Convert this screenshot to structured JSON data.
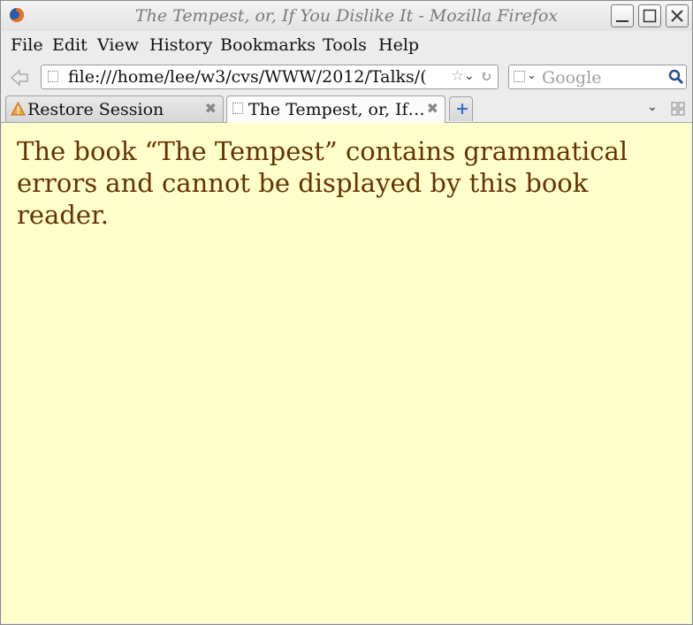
{
  "window": {
    "title": "The Tempest, or, If You Dislike It - Mozilla Firefox",
    "icon": "firefox-logo-icon",
    "controls": [
      "minimize-icon",
      "maximize-icon",
      "close-icon"
    ]
  },
  "menu": {
    "file": "File",
    "edit": "Edit",
    "view": "View",
    "history": "History",
    "bookmarks": "Bookmarks",
    "tools": "Tools",
    "help": "Help"
  },
  "navbar": {
    "url": "file:///home/lee/w3/cvs/WWW/2012/Talks/(",
    "search_placeholder": "Google"
  },
  "tabs": [
    {
      "label": "Restore Session",
      "icon": "warning-icon",
      "active": false
    },
    {
      "label": "The Tempest, or, If…",
      "icon": "page-icon",
      "active": true
    }
  ],
  "content": {
    "message": "The book “The Tempest” contains grammatical errors and cannot be displayed by this book reader."
  },
  "colors": {
    "content_background": "#ffffcc",
    "message_text": "#663300",
    "newtab_plus": "#3b6fc2"
  }
}
